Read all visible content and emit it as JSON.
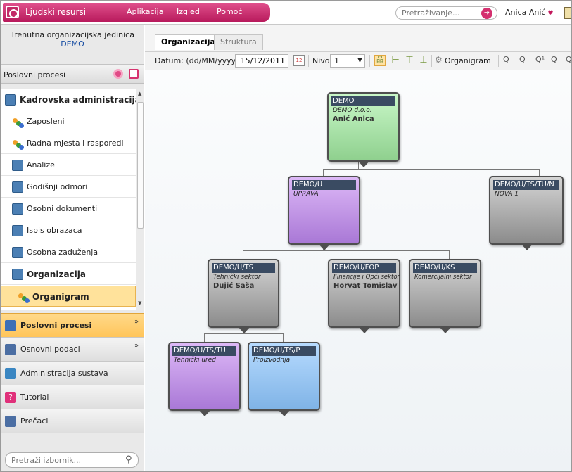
{
  "app": {
    "title": "Ljudski resursi",
    "menus": [
      "Aplikacija",
      "Izgled",
      "Pomoć"
    ]
  },
  "search": {
    "placeholder": "Pretraživanje..."
  },
  "user": {
    "name": "Anica Anić"
  },
  "sidebar": {
    "org_unit_label": "Trenutna organizacijska jedinica",
    "org_unit_value": "DEMO",
    "section_title": "Poslovni procesi",
    "menu": [
      {
        "label": "Kadrovska administracija",
        "icon": "folder-icon",
        "bold": true
      },
      {
        "label": "Zaposleni",
        "icon": "people-icon"
      },
      {
        "label": "Radna mjesta i rasporedi",
        "icon": "people-icon"
      },
      {
        "label": "Analize",
        "icon": "grid-icon"
      },
      {
        "label": "Godišnji odmori",
        "icon": "folder-icon"
      },
      {
        "label": "Osobni dokumenti",
        "icon": "folder-icon"
      },
      {
        "label": "Ispis obrazaca",
        "icon": "folder-icon"
      },
      {
        "label": "Osobna zaduženja",
        "icon": "folder-icon"
      },
      {
        "label": "Organizacija",
        "icon": "grid-icon",
        "bold": true
      },
      {
        "label": "Organigram",
        "icon": "people-icon",
        "bold": true,
        "selected": true
      }
    ],
    "accordion": [
      {
        "label": "Poslovni procesi",
        "color": "#3d6fb6",
        "active": true
      },
      {
        "label": "Osnovni podaci",
        "color": "#4b6ea3"
      },
      {
        "label": "Administracija sustava",
        "color": "#3a86c2"
      },
      {
        "label": "Tutorial",
        "color": "#e0307a"
      },
      {
        "label": "Prečaci",
        "color": "#4b6ea3"
      }
    ],
    "search_placeholder": "Pretraži izbornik..."
  },
  "tabs": [
    {
      "label": "Organizacija",
      "active": true
    },
    {
      "label": "Struktura"
    }
  ],
  "toolbar": {
    "date_label": "Datum: (dd/MM/yyyy)",
    "date_value": "15/12/2011",
    "nivo_label": "Nivo",
    "nivo_value": "1",
    "organigram_label": "Organigram"
  },
  "org": [
    {
      "code": "DEMO",
      "name": "DEMO d.o.o.",
      "person": "Anić Anica",
      "color": "green"
    },
    {
      "code": "DEMO/U",
      "name": "UPRAVA",
      "person": "",
      "color": "purple"
    },
    {
      "code": "DEMO/U/TS/TU/N",
      "name": "NOVA 1",
      "person": "",
      "color": "gray"
    },
    {
      "code": "DEMO/U/TS",
      "name": "Tehnički sektor",
      "person": "Dujić Saša",
      "color": "gray"
    },
    {
      "code": "DEMO/U/FOP",
      "name": "Financije i Opći sektor",
      "person": "Horvat Tomislav",
      "color": "gray"
    },
    {
      "code": "DEMO/U/KS",
      "name": "Komercijalni sektor",
      "person": "",
      "color": "gray"
    },
    {
      "code": "DEMO/U/TS/TU",
      "name": "Tehnički ured",
      "person": "",
      "color": "purple"
    },
    {
      "code": "DEMO/U/TS/P",
      "name": "Proizvodnja",
      "person": "",
      "color": "blue"
    }
  ]
}
